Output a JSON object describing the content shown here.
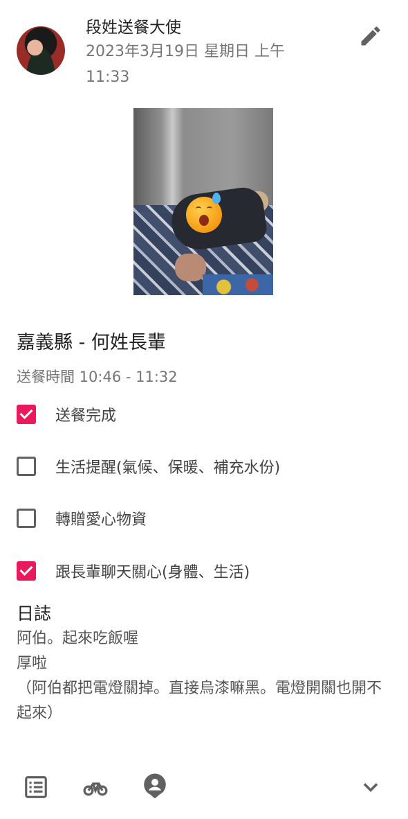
{
  "post": {
    "author": "段姓送餐大使",
    "timestamp": "2023年3月19日 星期日 上午\n11:33"
  },
  "record": {
    "recipient": "嘉義縣 - 何姓長輩",
    "delivery_time": "送餐時間 10:46 - 11:32"
  },
  "checklist": [
    {
      "label": "送餐完成",
      "checked": true
    },
    {
      "label": "生活提醒(氣候、保暖、補充水份)",
      "checked": false
    },
    {
      "label": "轉贈愛心物資",
      "checked": false
    },
    {
      "label": "跟長輩聊天關心(身體、生活)",
      "checked": true
    }
  ],
  "log": {
    "title": "日誌",
    "body": "阿伯。起來吃飯喔\n厚啦\n（阿伯都把電燈關掉。直接烏漆嘛黑。電燈開關也開不起來）"
  },
  "icons": {
    "edit": "pencil-icon",
    "list": "list-icon",
    "bike": "bicycle-icon",
    "account": "account-pin-icon",
    "expand": "chevron-down-icon"
  },
  "colors": {
    "accent": "#e9195c",
    "icon": "#616161",
    "secondary_text": "#757575"
  }
}
